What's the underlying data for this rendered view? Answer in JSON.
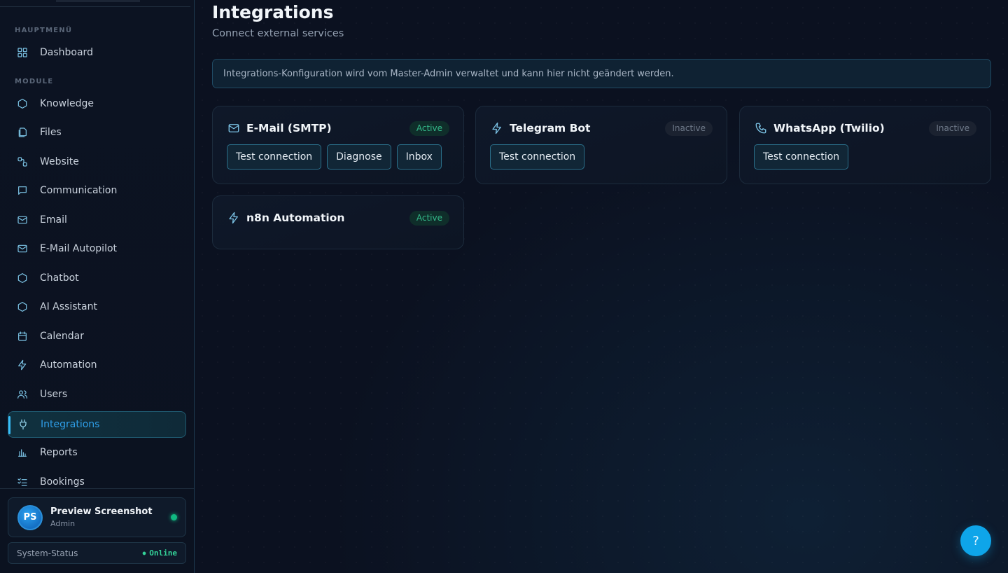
{
  "sidebar": {
    "sections": [
      {
        "label": "HAUPTMENÜ"
      },
      {
        "label": "MODULE"
      }
    ],
    "main_items": [
      {
        "label": "Dashboard",
        "icon": "grid-icon"
      }
    ],
    "module_items": [
      {
        "label": "Knowledge",
        "icon": "hexagon-icon"
      },
      {
        "label": "Files",
        "icon": "files-icon"
      },
      {
        "label": "Website",
        "icon": "link-nodes-icon"
      },
      {
        "label": "Communication",
        "icon": "chat-icon"
      },
      {
        "label": "Email",
        "icon": "mail-icon"
      },
      {
        "label": "E-Mail Autopilot",
        "icon": "mail-icon"
      },
      {
        "label": "Chatbot",
        "icon": "hexagon-icon"
      },
      {
        "label": "AI Assistant",
        "icon": "hexagon-icon"
      },
      {
        "label": "Calendar",
        "icon": "calendar-icon"
      },
      {
        "label": "Automation",
        "icon": "lightning-icon"
      },
      {
        "label": "Users",
        "icon": "users-icon"
      },
      {
        "label": "Integrations",
        "icon": "plug-icon",
        "active": true
      },
      {
        "label": "Reports",
        "icon": "bar-chart-icon"
      },
      {
        "label": "Bookings",
        "icon": "checklist-icon"
      }
    ],
    "user": {
      "initials": "PS",
      "name": "Preview Screenshot",
      "role": "Admin",
      "online_color": "#10b981"
    },
    "system_status": {
      "label": "System-Status",
      "value": "Online"
    }
  },
  "main": {
    "title": "Integrations",
    "subtitle": "Connect external services",
    "notice": "Integrations-Konfiguration wird vom Master-Admin verwaltet und kann hier nicht geändert werden.",
    "cards": [
      {
        "title": "E-Mail (SMTP)",
        "icon": "mail-icon",
        "status": "Active",
        "buttons": [
          "Test connection",
          "Diagnose",
          "Inbox"
        ]
      },
      {
        "title": "Telegram Bot",
        "icon": "lightning-icon",
        "status": "Inactive",
        "buttons": [
          "Test connection"
        ]
      },
      {
        "title": "WhatsApp (Twilio)",
        "icon": "phone-icon",
        "status": "Inactive",
        "buttons": [
          "Test connection"
        ]
      },
      {
        "title": "n8n Automation",
        "icon": "lightning-icon",
        "status": "Active",
        "buttons": []
      }
    ],
    "help_label": "?"
  },
  "colors": {
    "accent": "#38bdf8",
    "active_badge": "#34b98a",
    "help_button": "#0ea5e9"
  }
}
